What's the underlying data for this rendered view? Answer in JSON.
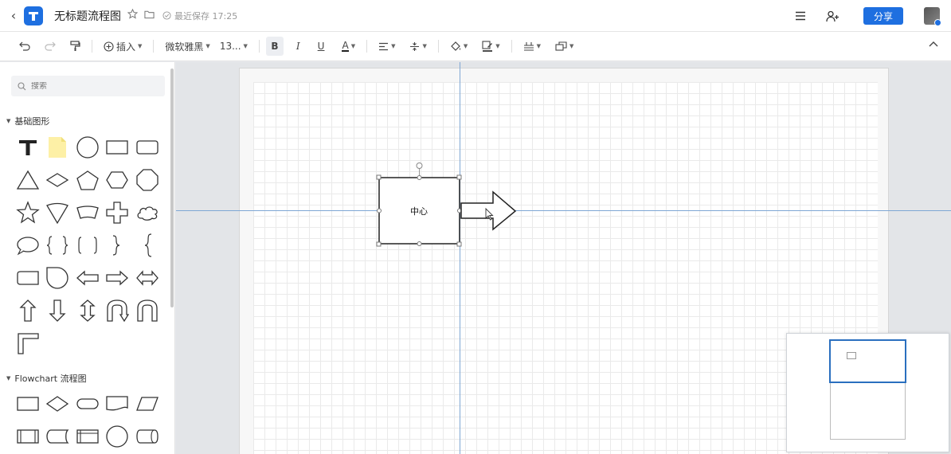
{
  "header": {
    "title": "无标题流程图",
    "save_status": "最近保存 17:25",
    "share_label": "分享"
  },
  "toolbar": {
    "insert_label": "插入",
    "font_family": "微软雅黑",
    "font_size": "13...",
    "bold_label": "B",
    "italic_label": "I",
    "underline_label": "U",
    "font_color_label": "A"
  },
  "sidebar": {
    "search_placeholder": "搜索",
    "sections": [
      {
        "title": "基础图形"
      },
      {
        "title": "Flowchart 流程图"
      }
    ]
  },
  "canvas": {
    "shape_text": "中心"
  },
  "colors": {
    "accent": "#1e6fe0",
    "guide": "#7fa7d4",
    "note_yellow": "#fdf0a6"
  }
}
